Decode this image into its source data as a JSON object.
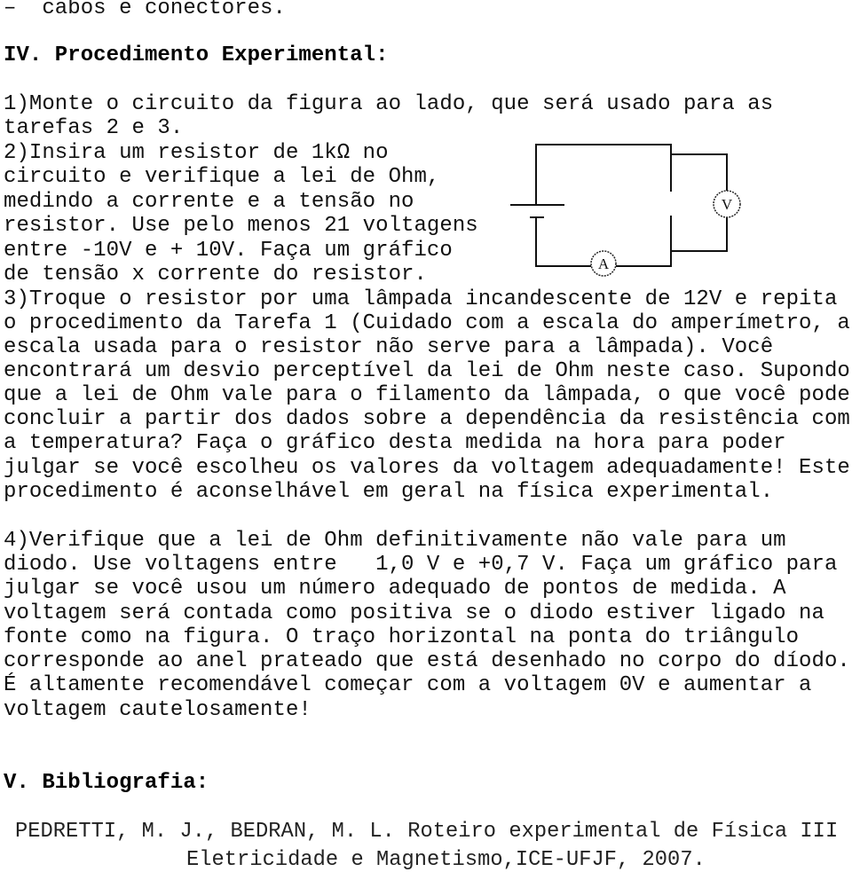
{
  "materials_tail": "–  cabos e conectores.",
  "section4": {
    "heading": "IV. Procedimento Experimental:",
    "lines": [
      "1)Monte o circuito da figura ao lado, que será usado para as",
      "tarefas 2 e 3.",
      "2)Insira um resistor de 1kΩ no",
      "circuito e verifique a lei de Ohm,",
      "medindo a corrente e a tensão no",
      "resistor. Use pelo menos 21 voltagens",
      "entre -10V e + 10V. Faça um gráfico",
      "de tensão x corrente do resistor.",
      "3)Troque o resistor por uma lâmpada incandescente de 12V e repita",
      "o procedimento da Tarefa 1 (Cuidado com a escala do amperímetro, a",
      "escala usada para o resistor não serve para a lâmpada). Você",
      "encontrará um desvio perceptível da lei de Ohm neste caso. Supondo",
      "que a lei de Ohm vale para o filamento da lâmpada, o que você pode",
      "concluir a partir dos dados sobre a dependência da resistência com",
      "a temperatura? Faça o gráfico desta medida na hora para poder",
      "julgar se você escolheu os valores da voltagem adequadamente! Este",
      "procedimento é aconselhável em geral na física experimental.",
      "4)Verifique que a lei de Ohm definitivamente não vale para um",
      "diodo. Use voltagens entre   1,0 V e +0,7 V. Faça um gráfico para",
      "julgar se você usou um número adequado de pontos de medida. A",
      "voltagem será contada como positiva se o diodo estiver ligado na",
      "fonte como na figura. O traço horizontal na ponta do triângulo",
      "corresponde ao anel prateado que está desenhado no corpo do díodo.",
      "É altamente recomendável começar com a voltagem 0V e aumentar a",
      "voltagem cautelosamente!"
    ]
  },
  "circuit": {
    "ammeter_label": "A",
    "voltmeter_label": "V"
  },
  "section5": {
    "heading": "V. Bibliografia:",
    "reference_line1": "PEDRETTI, M. J., BEDRAN, M. L. Roteiro experimental de Física III",
    "reference_line2": "Eletricidade e Magnetismo,ICE-UFJF, 2007."
  }
}
